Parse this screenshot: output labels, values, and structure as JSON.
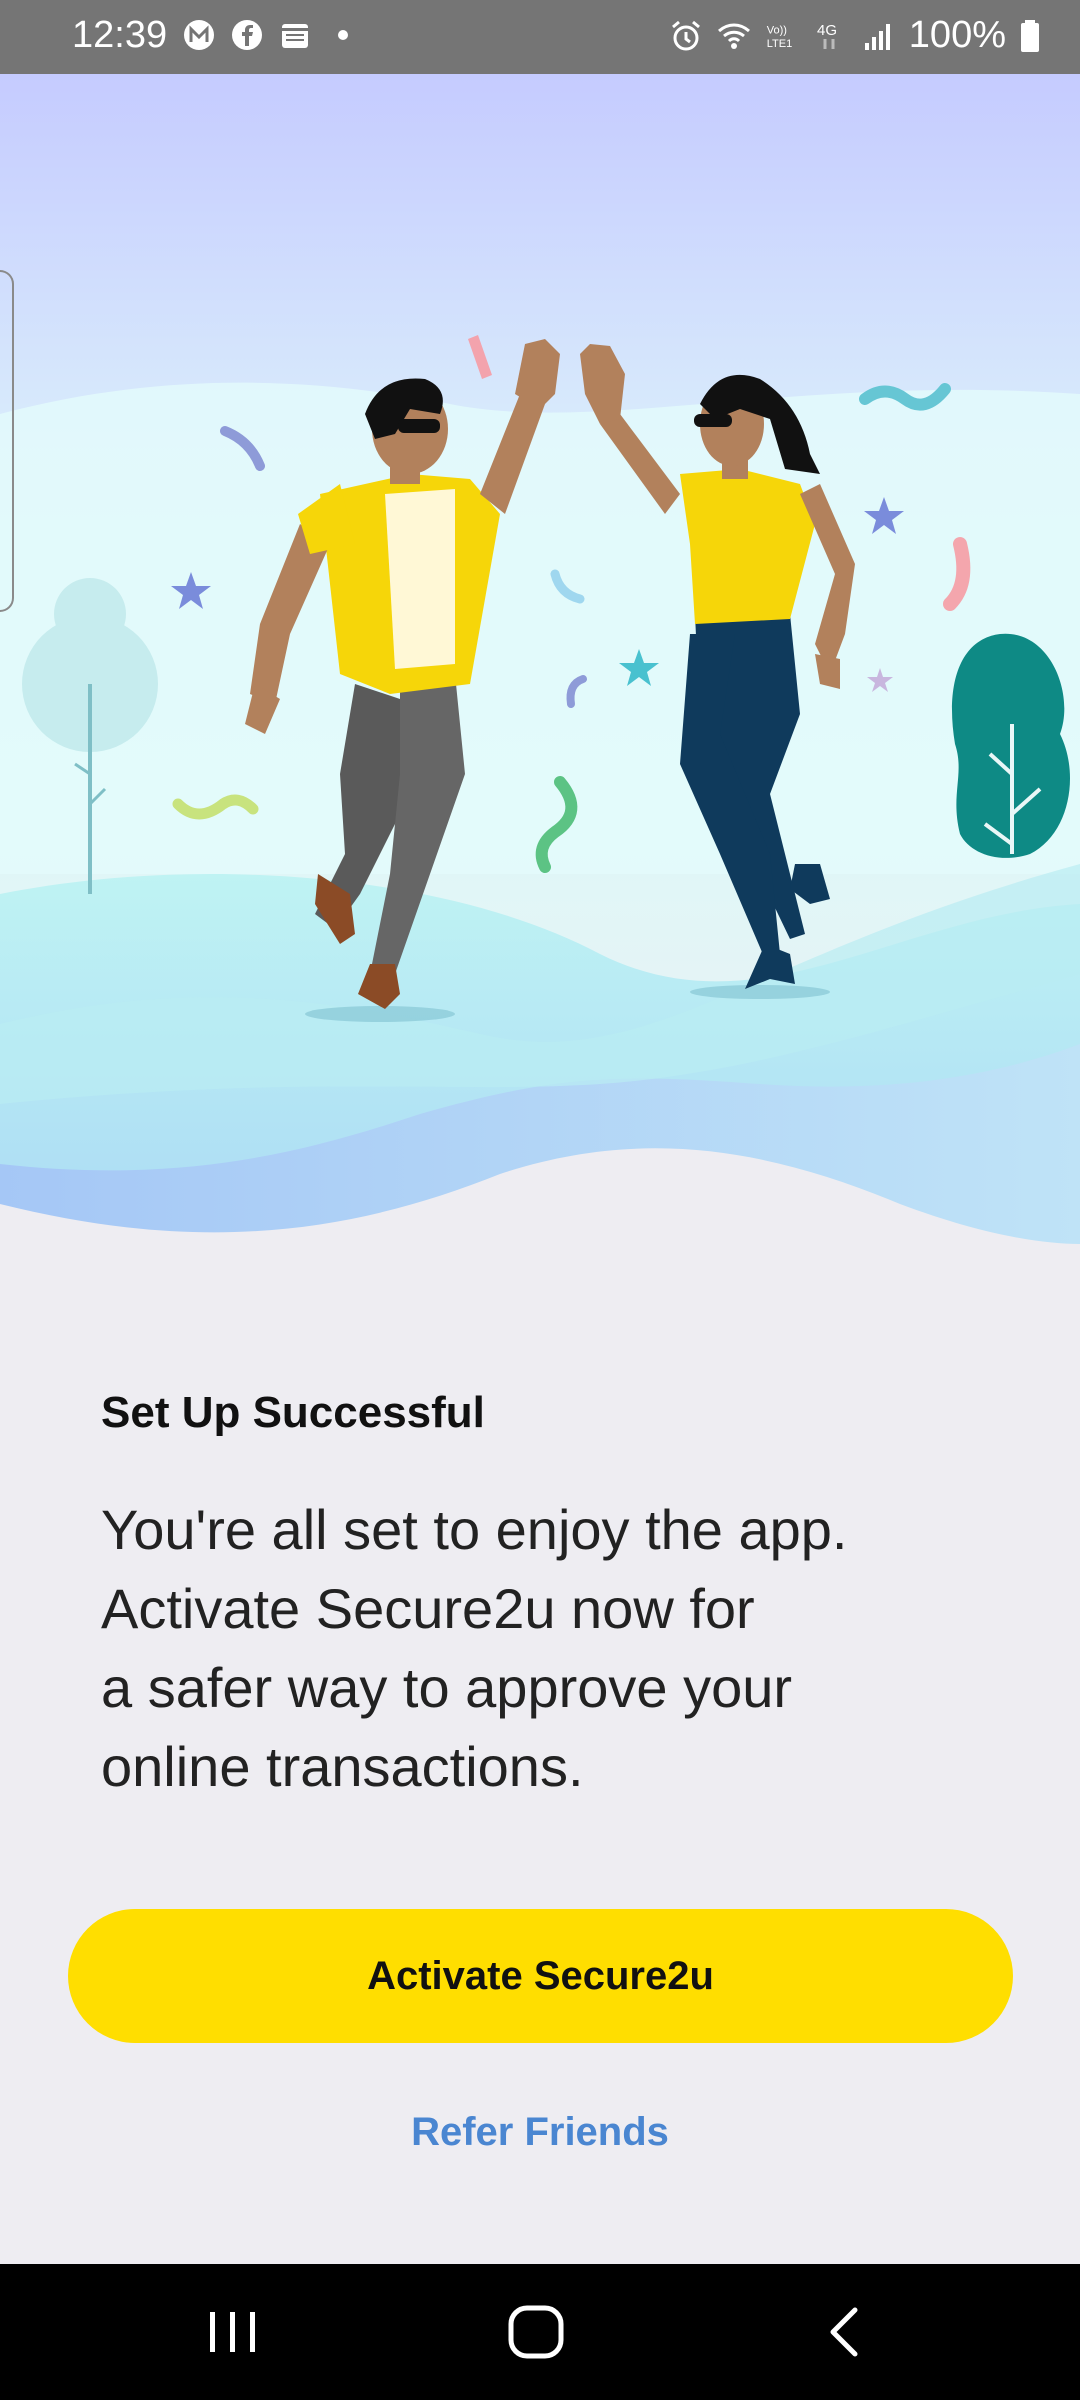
{
  "status_bar": {
    "time": "12:39",
    "battery": "100%",
    "left_icons": [
      "m-app-icon",
      "facebook-icon",
      "calendar-icon",
      "dot-icon"
    ],
    "right_icons": [
      "alarm-icon",
      "wifi-icon",
      "volte-icon",
      "4g-icon",
      "signal-icon",
      "battery-icon"
    ]
  },
  "content": {
    "heading": "Set Up Successful",
    "message_lines": [
      "You're all set to enjoy the app.",
      "Activate Secure2u now for",
      "a safer way to approve your",
      "online transactions."
    ],
    "primary_button": "Activate Secure2u",
    "secondary_link": "Refer Friends"
  },
  "nav_bar": {
    "buttons": [
      "recents-icon",
      "home-icon",
      "back-icon"
    ]
  },
  "colors": {
    "accent": "#ffde00",
    "link": "#4a86d1",
    "background": "#eeedf2"
  }
}
